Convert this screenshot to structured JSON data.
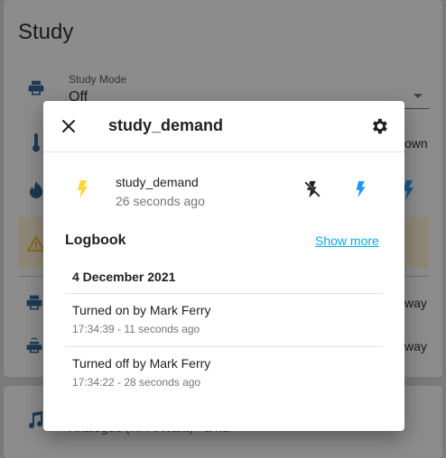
{
  "background": {
    "title": "Study",
    "study_mode_label": "Study Mode",
    "study_mode_value": "Off",
    "right_text_1": "own",
    "right_text_2": "way",
    "right_text_3": "way",
    "bottom_text": "Analogue (Hi-Fi/Want) - a ha",
    "colors": {
      "warning": "#c08a2a",
      "icon": "#1d3a55"
    }
  },
  "dialog": {
    "title": "study_demand",
    "entity": {
      "name": "study_demand",
      "last_changed": "26 seconds ago",
      "state_color": "#fdd835",
      "on_color": "#2196f3"
    },
    "logbook": {
      "title": "Logbook",
      "show_more": "Show more",
      "date": "4 December 2021",
      "entries": [
        {
          "message": "Turned on by Mark Ferry",
          "time": "17:34:39 - 11 seconds ago"
        },
        {
          "message": "Turned off by Mark Ferry",
          "time": "17:34:22 - 28 seconds ago"
        }
      ]
    }
  }
}
